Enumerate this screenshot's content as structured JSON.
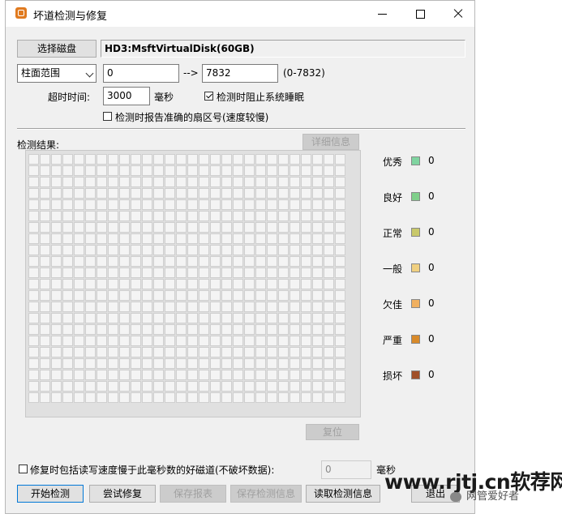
{
  "window": {
    "title": "坏道检测与修复"
  },
  "disk": {
    "select_button": "选择磁盘",
    "name": "HD3:MsftVirtualDisk(60GB)"
  },
  "range": {
    "mode": "柱面范围",
    "start": "0",
    "arrow": "-->",
    "end": "7832",
    "hint": "(0-7832)"
  },
  "timeout": {
    "label": "超时时间:",
    "value": "3000",
    "unit": "毫秒",
    "prevent_sleep_label": "检测时阻止系统睡眠",
    "report_sector_label": "检测时报告准确的扇区号(速度较慢)"
  },
  "results": {
    "label": "检测结果:",
    "details_button": "详细信息",
    "reset_button": "复位"
  },
  "legend": [
    {
      "label": "优秀",
      "count": "0",
      "color": "#7fd4a0"
    },
    {
      "label": "良好",
      "count": "0",
      "color": "#7fcf8a"
    },
    {
      "label": "正常",
      "count": "0",
      "color": "#c8c86a"
    },
    {
      "label": "一般",
      "count": "0",
      "color": "#f0d080"
    },
    {
      "label": "欠佳",
      "count": "0",
      "color": "#f0b060"
    },
    {
      "label": "严重",
      "count": "0",
      "color": "#d88a2a"
    },
    {
      "label": "损坏",
      "count": "0",
      "color": "#a0502a"
    }
  ],
  "repair_option": {
    "label": "修复时包括读写速度慢于此毫秒数的好磁道(不破坏数据):",
    "value": "0",
    "unit": "毫秒"
  },
  "actions": {
    "start": "开始检测",
    "try_repair": "尝试修复",
    "save_report": "保存报表",
    "save_info": "保存检测信息",
    "read_info": "读取检测信息",
    "exit": "退出"
  },
  "watermark": {
    "site": "www.rjtj.cn软荐网",
    "wechat": "网管爱好者"
  }
}
